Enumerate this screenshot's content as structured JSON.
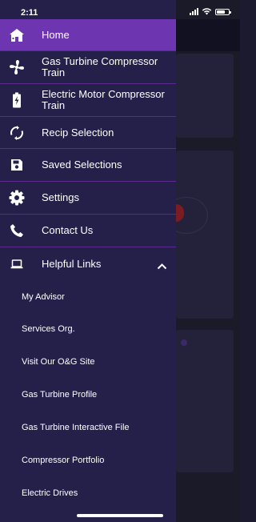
{
  "status_bar": {
    "time": "2:11"
  },
  "drawer": {
    "menu": [
      {
        "label": "Home",
        "icon": "home-icon"
      },
      {
        "label": "Gas Turbine Compressor Train",
        "icon": "fan-icon"
      },
      {
        "label": "Electric Motor Compressor Train",
        "icon": "battery-icon"
      },
      {
        "label": "Recip Selection",
        "icon": "sync-icon"
      },
      {
        "label": "Saved Selections",
        "icon": "save-icon"
      },
      {
        "label": "Settings",
        "icon": "gear-icon"
      },
      {
        "label": "Contact Us",
        "icon": "phone-icon"
      },
      {
        "label": "Helpful Links",
        "icon": "laptop-icon"
      }
    ],
    "helpful_links": [
      "My Advisor",
      "Services Org.",
      "Visit Our O&G Site",
      "Gas Turbine Profile",
      "Gas Turbine Interactive File",
      "Compressor Portfolio",
      "Electric Drives"
    ]
  },
  "colors": {
    "drawer_bg": "#24204a",
    "active_bg": "#6e35b0",
    "divider": "#5a2a8e"
  }
}
